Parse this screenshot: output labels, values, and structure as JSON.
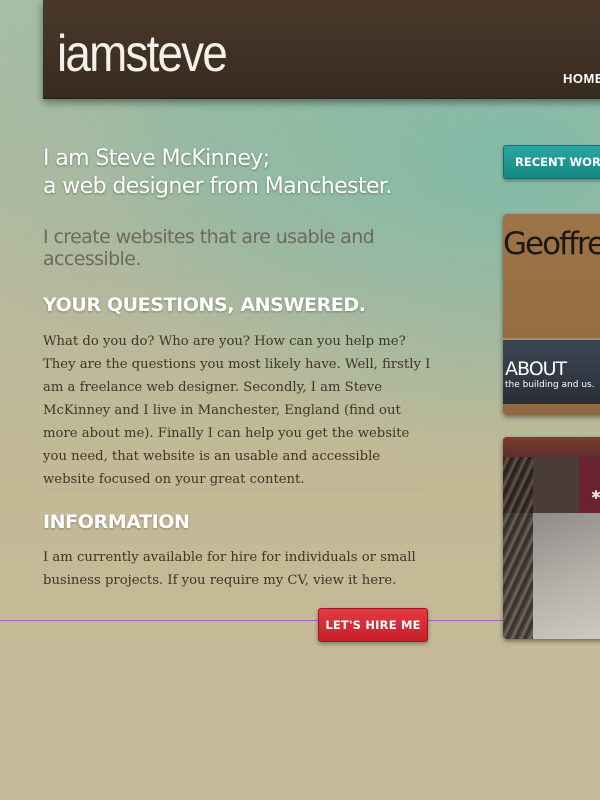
{
  "header": {
    "logo": "iamsteve",
    "nav": {
      "home": "HOME"
    }
  },
  "main": {
    "intro_line1": "I am Steve McKinney;",
    "intro_line2": "a web designer from Manchester.",
    "tagline": "I create websites that are usable and accessible.",
    "questions": {
      "heading": "YOUR QUESTIONS, ANSWERED.",
      "body": "What do you do? Who are you? How can you help me? They are the questions you most likely have. Well, firstly I am a freelance web designer. Secondly, I am Steve McKinney and I live in Manchester, England (find out more about me). Finally I can help you get the website you need, that website is an usable and accessible website focused on your great content."
    },
    "information": {
      "heading": "INFORMATION",
      "body": "I am currently available for hire for individuals or small business projects. If you require my CV, view it here."
    },
    "hire_button": "LET'S HIRE ME"
  },
  "sidebar": {
    "recent_work_button": "RECENT WORK",
    "thumbs": [
      {
        "brand": "Geoffrey",
        "about": "ABOUT",
        "about_sub": "the building and us."
      }
    ]
  },
  "colors": {
    "header": "#3f3024",
    "accent_teal": "#1f9694",
    "accent_red": "#d12c37",
    "guide_line": "#b64fd0"
  }
}
